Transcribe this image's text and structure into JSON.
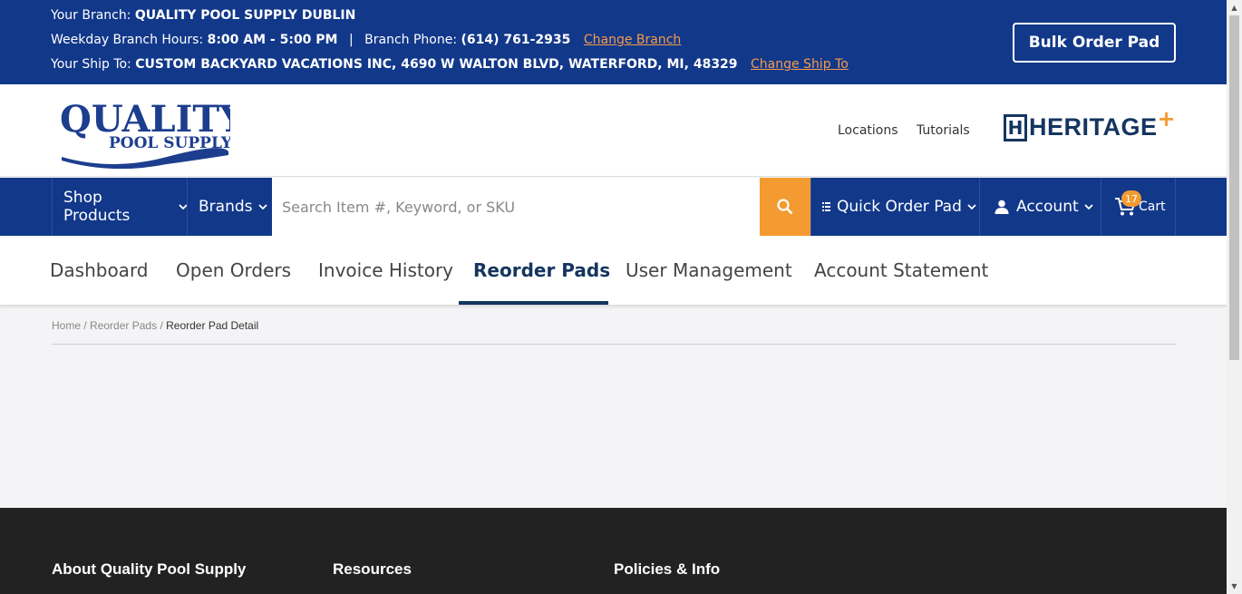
{
  "topbar": {
    "branch_label": "Your Branch:",
    "branch_name": "QUALITY POOL SUPPLY DUBLIN",
    "hours_label": "Weekday Branch Hours:",
    "hours_value": "8:00 AM - 5:00 PM",
    "separator": "|",
    "phone_label": "Branch Phone:",
    "phone_value": "(614) 761-2935",
    "change_branch": "Change Branch",
    "ship_label": "Your Ship To:",
    "ship_value": "CUSTOM BACKYARD VACATIONS INC, 4690 W WALTON BLVD, WATERFORD, MI, 48329",
    "change_ship": "Change Ship To",
    "bulk_order": "Bulk Order Pad"
  },
  "header": {
    "logo_line1": "QUALITY",
    "logo_line2": "POOL SUPPLY",
    "links": [
      "Locations",
      "Tutorials"
    ],
    "partner_logo_text": "HERITAGE",
    "partner_logo_letter": "H",
    "partner_logo_plus": "+"
  },
  "nav": {
    "shop_products": "Shop Products",
    "brands": "Brands",
    "search_placeholder": "Search Item #, Keyword, or SKU",
    "quick_order": "Quick Order Pad",
    "account": "Account",
    "cart": "Cart",
    "cart_count": "17",
    "accent": "#f39b30",
    "brand_color": "#12388a"
  },
  "tabs": {
    "items": [
      "Dashboard",
      "Open Orders",
      "Invoice History",
      "Reorder Pads",
      "User Management",
      "Account Statement"
    ],
    "active": "Reorder Pads"
  },
  "breadcrumb": {
    "home": "Home",
    "sep": "/",
    "reorder_pads": "Reorder Pads",
    "current": "Reorder Pad Detail"
  },
  "footer": {
    "columns": [
      "About Quality Pool Supply",
      "Resources",
      "Policies & Info"
    ]
  }
}
